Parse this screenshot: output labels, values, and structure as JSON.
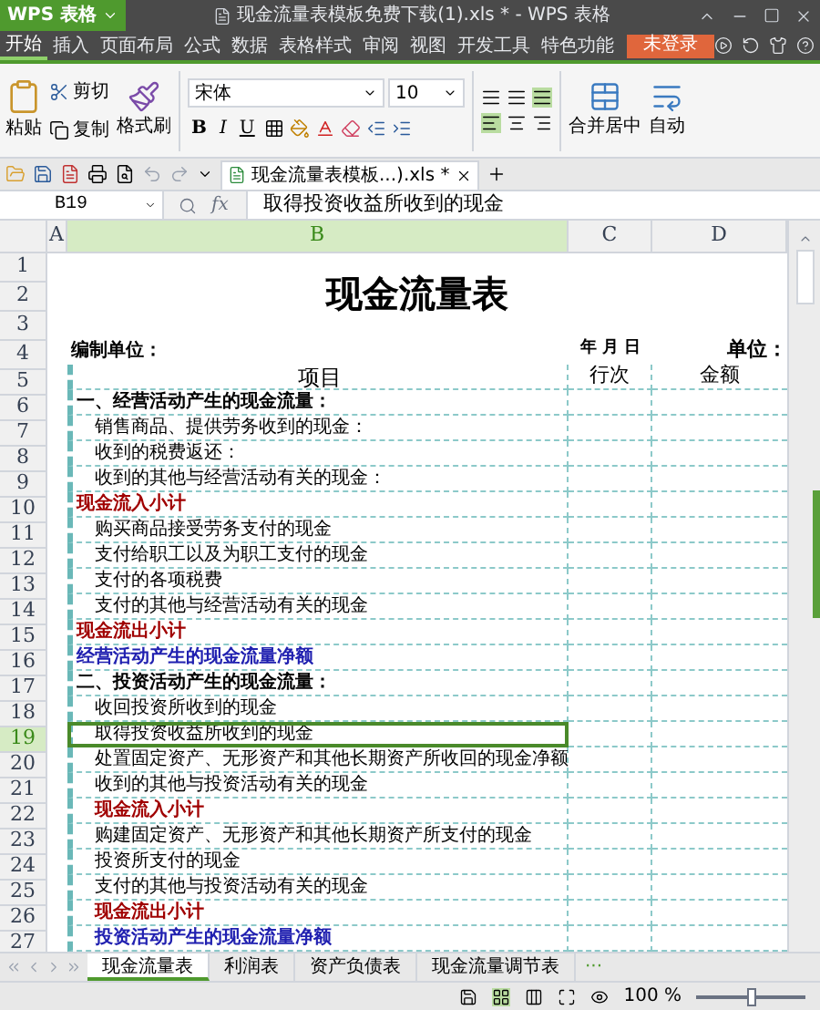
{
  "title_bar": {
    "app_button": "WPS 表格",
    "title": "现金流量表模板免费下载(1).xls * - WPS 表格"
  },
  "menu": {
    "items": [
      {
        "label": "开始",
        "selected": true
      },
      {
        "label": "插入",
        "selected": false
      },
      {
        "label": "页面布局",
        "selected": false
      },
      {
        "label": "公式",
        "selected": false
      },
      {
        "label": "数据",
        "selected": false
      },
      {
        "label": "表格样式",
        "selected": false
      },
      {
        "label": "审阅",
        "selected": false
      },
      {
        "label": "视图",
        "selected": false
      },
      {
        "label": "开发工具",
        "selected": false
      },
      {
        "label": "特色功能",
        "selected": false
      }
    ],
    "login_button": "未登录"
  },
  "ribbon": {
    "paste": "粘贴",
    "cut": "剪切",
    "copy": "复制",
    "format_painter": "格式刷",
    "font": "宋体",
    "font_size": "10",
    "bold": "B",
    "italic": "I",
    "underline": "U",
    "merge": "合并居中",
    "wrap": "自动"
  },
  "document_tabs": [
    {
      "label": "现金流量表模板...).xls *",
      "selected": true
    }
  ],
  "formula_bar": {
    "cell_ref": "B19",
    "fx": "fx",
    "value": "取得投资收益所收到的现金"
  },
  "columns": [
    {
      "label": "A",
      "selected": false
    },
    {
      "label": "B",
      "selected": true
    },
    {
      "label": "C",
      "selected": false
    },
    {
      "label": "D",
      "selected": false
    }
  ],
  "sheet": {
    "title": "现金流量表",
    "rows": [
      {
        "number": "1",
        "kind": "title_area",
        "selected": false
      },
      {
        "number": "2",
        "kind": "title_area",
        "selected": false
      },
      {
        "number": "3",
        "kind": "title_area",
        "selected": false
      },
      {
        "number": "4",
        "kind": "info",
        "item": "编制单位：",
        "column_c": "年  月  日",
        "column_d": "单位：",
        "selected": false
      },
      {
        "number": "5",
        "kind": "header",
        "item": "项目",
        "column_c": "行次",
        "column_d": "金额",
        "selected": false
      },
      {
        "number": "6",
        "kind": "section",
        "item": "一、经营活动产生的现金流量：",
        "selected": false
      },
      {
        "number": "7",
        "kind": "line",
        "item": "销售商品、提供劳务收到的现金：",
        "selected": false
      },
      {
        "number": "8",
        "kind": "line",
        "item": "收到的税费返还：",
        "selected": false
      },
      {
        "number": "9",
        "kind": "line",
        "item": "收到的其他与经营活动有关的现金：",
        "selected": false
      },
      {
        "number": "10",
        "kind": "subtotal",
        "item": "现金流入小计",
        "selected": false
      },
      {
        "number": "11",
        "kind": "line",
        "item": "购买商品接受劳务支付的现金",
        "selected": false
      },
      {
        "number": "12",
        "kind": "line",
        "item": "支付给职工以及为职工支付的现金",
        "selected": false
      },
      {
        "number": "13",
        "kind": "line",
        "item": "支付的各项税费",
        "selected": false
      },
      {
        "number": "14",
        "kind": "line",
        "item": "支付的其他与经营活动有关的现金",
        "selected": false
      },
      {
        "number": "15",
        "kind": "subtotal",
        "item": "现金流出小计",
        "selected": false
      },
      {
        "number": "16",
        "kind": "net",
        "item": "经营活动产生的现金流量净额",
        "selected": false
      },
      {
        "number": "17",
        "kind": "section",
        "item": "二、投资活动产生的现金流量：",
        "selected": false
      },
      {
        "number": "18",
        "kind": "line",
        "item": "收回投资所收到的现金",
        "selected": false
      },
      {
        "number": "19",
        "kind": "line",
        "item": "取得投资收益所收到的现金",
        "selected": true
      },
      {
        "number": "20",
        "kind": "line",
        "item": "处置固定资产、无形资产和其他长期资产所收回的现金净额",
        "selected": false
      },
      {
        "number": "21",
        "kind": "line",
        "item": "收到的其他与投资活动有关的现金",
        "selected": false
      },
      {
        "number": "22",
        "kind": "subtotal_indented",
        "item": "现金流入小计",
        "selected": false
      },
      {
        "number": "23",
        "kind": "line",
        "item": "购建固定资产、无形资产和其他长期资产所支付的现金",
        "selected": false
      },
      {
        "number": "24",
        "kind": "line",
        "item": "投资所支付的现金",
        "selected": false
      },
      {
        "number": "25",
        "kind": "line",
        "item": "支付的其他与投资活动有关的现金",
        "selected": false
      },
      {
        "number": "26",
        "kind": "subtotal_indented",
        "item": "现金流出小计",
        "selected": false
      },
      {
        "number": "27",
        "kind": "net_indented",
        "item": "投资活动产生的现金流量净额",
        "selected": false
      }
    ]
  },
  "sheet_tabs": [
    {
      "label": "现金流量表",
      "selected": true
    },
    {
      "label": "利润表",
      "selected": false
    },
    {
      "label": "资产负债表",
      "selected": false
    },
    {
      "label": "现金流量调节表",
      "selected": false
    }
  ],
  "more_sheets": "···",
  "status_bar": {
    "zoom": "100 %",
    "zoom_slider": {
      "level": 0.5
    }
  }
}
